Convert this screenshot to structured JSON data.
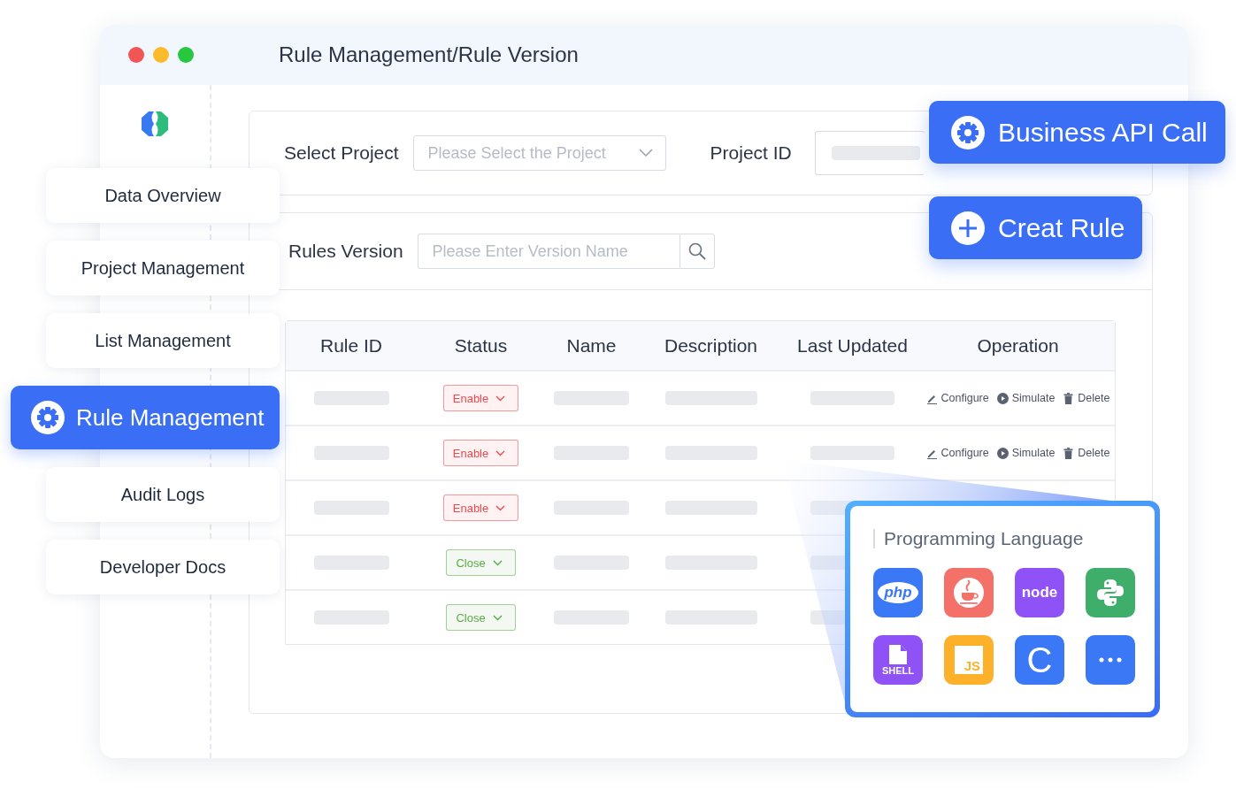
{
  "window": {
    "title": "Rule Management/Rule Version",
    "lights": [
      {
        "color": "#f25555"
      },
      {
        "color": "#fbbb2c"
      },
      {
        "color": "#27c840"
      }
    ]
  },
  "sidebar": {
    "items": [
      {
        "label": "Data Overview",
        "selected": false
      },
      {
        "label": "Project Management",
        "selected": false
      },
      {
        "label": "List Management",
        "selected": false
      },
      {
        "label": "Rule Management",
        "selected": true
      },
      {
        "label": "Audit Logs",
        "selected": false
      },
      {
        "label": "Developer Docs",
        "selected": false
      }
    ]
  },
  "project_select": {
    "label": "Select Project",
    "placeholder": "Please Select the Project"
  },
  "project_id": {
    "label": "Project ID"
  },
  "version_search": {
    "label": "Rules Version",
    "placeholder": "Please Enter Version Name"
  },
  "actions": [
    {
      "kind": "settings",
      "label": "Business API Call"
    },
    {
      "kind": "add",
      "label": "Creat Rule"
    }
  ],
  "table": {
    "columns": [
      "Rule ID",
      "Status",
      "Name",
      "Description",
      "Last Updated",
      "Operation"
    ],
    "rows": [
      {
        "status": {
          "label": "Enable",
          "color": "#ee4a4e"
        },
        "operations": [
          {
            "kind": "configure",
            "label": "Configure"
          },
          {
            "kind": "simulate",
            "label": "Simulate"
          },
          {
            "kind": "delete",
            "label": "Delete"
          }
        ]
      },
      {
        "status": {
          "label": "Enable",
          "color": "#ee4a4e"
        },
        "operations": [
          {
            "kind": "configure",
            "label": "Configure"
          },
          {
            "kind": "simulate",
            "label": "Simulate"
          },
          {
            "kind": "delete",
            "label": "Delete"
          }
        ]
      },
      {
        "status": {
          "label": "Enable",
          "color": "#ee4a4e"
        }
      },
      {
        "status": {
          "label": "Close",
          "color": "#5aab44"
        }
      },
      {
        "status": {
          "label": "Close",
          "color": "#5aab44"
        }
      }
    ]
  },
  "language_panel": {
    "title": "Programming Language",
    "languages": [
      {
        "kind": "php",
        "label": "php",
        "color": "#3a78f6"
      },
      {
        "kind": "java",
        "color": "#f4716a"
      },
      {
        "kind": "node",
        "label": "node",
        "color": "#8f52f7"
      },
      {
        "kind": "python",
        "color": "#3fae6a"
      },
      {
        "kind": "shell",
        "label": "SHELL",
        "color": "#8f52f7"
      },
      {
        "kind": "js",
        "label": "JS",
        "color": "#fdb02a"
      },
      {
        "kind": "c",
        "label": "C",
        "color": "#3a78f6"
      },
      {
        "kind": "more",
        "color": "#3a78f6"
      }
    ]
  }
}
